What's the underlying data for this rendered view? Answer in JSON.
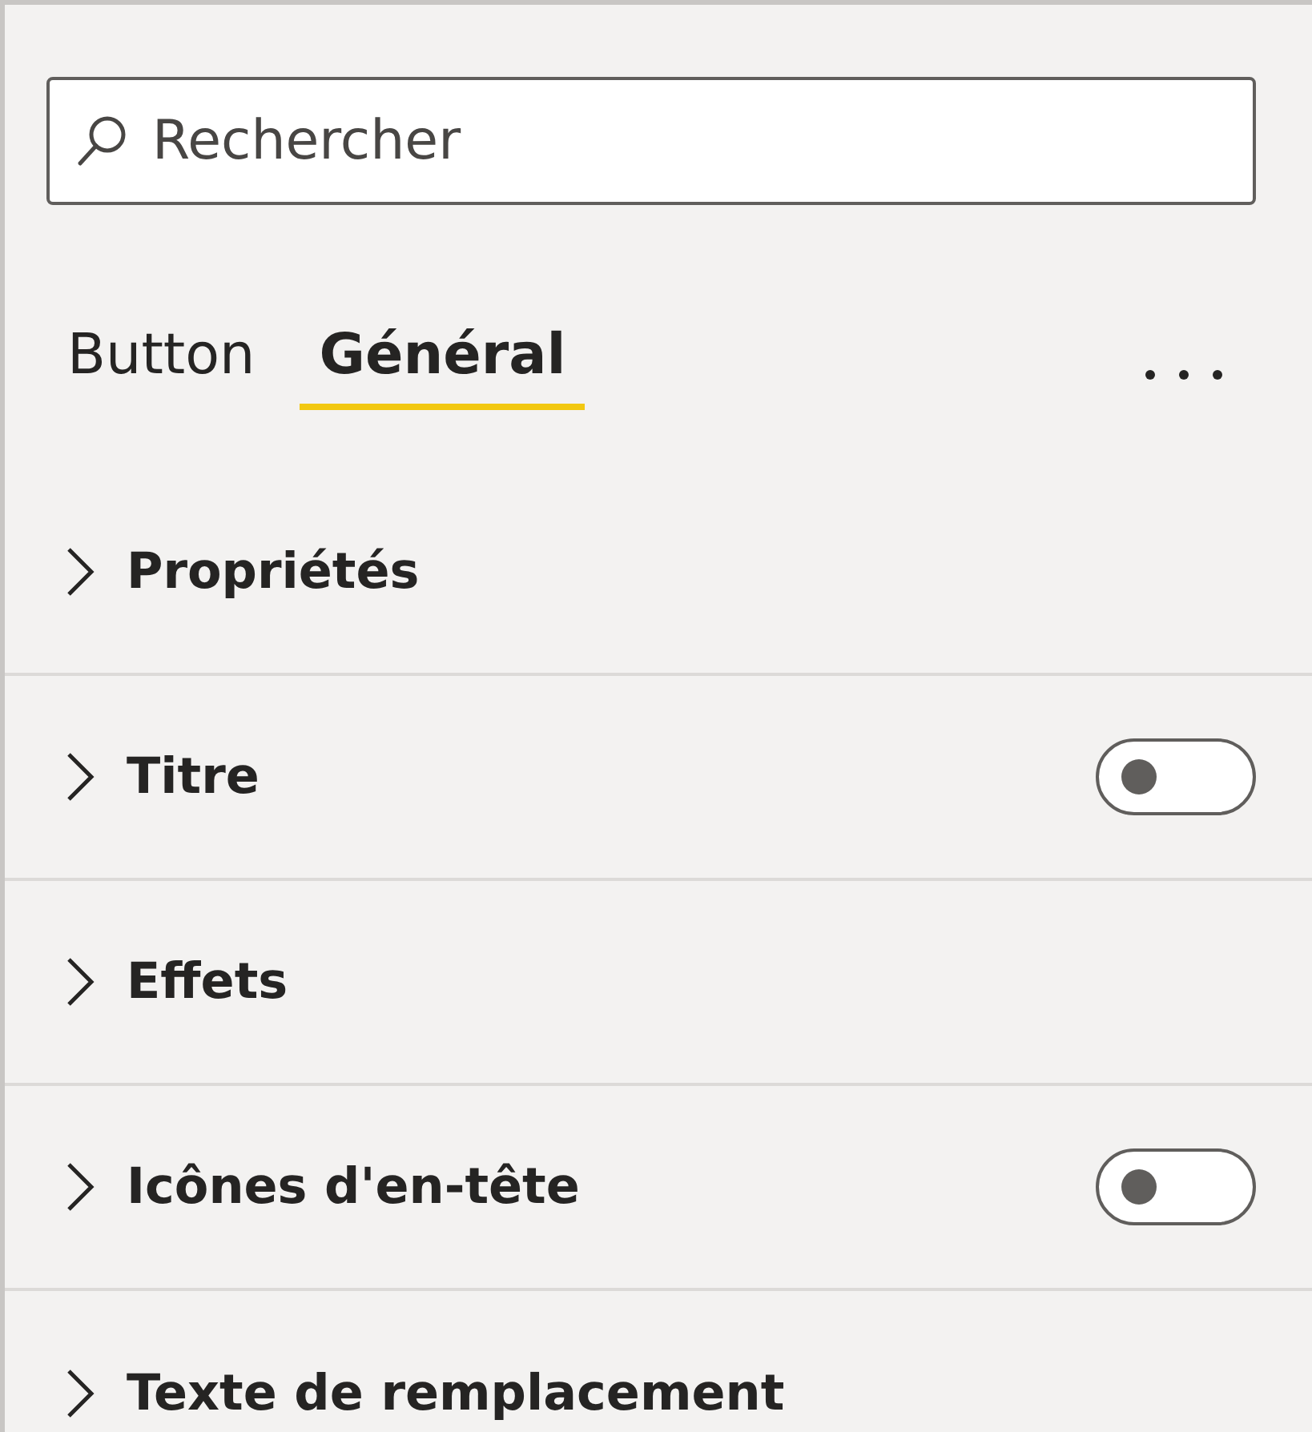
{
  "search": {
    "placeholder": "Rechercher"
  },
  "tabs": [
    {
      "label": "Button",
      "selected": false
    },
    {
      "label": "Général",
      "selected": true
    }
  ],
  "sections": [
    {
      "label": "Propriétés",
      "kind": "plain",
      "expanded": false
    },
    {
      "label": "Titre",
      "kind": "toggle",
      "expanded": false,
      "on": false
    },
    {
      "label": "Effets",
      "kind": "plain",
      "expanded": false
    },
    {
      "label": "Icônes d'en-tête",
      "kind": "toggle",
      "expanded": false,
      "on": false
    },
    {
      "label": "Texte de remplacement",
      "kind": "plain",
      "expanded": false
    }
  ]
}
